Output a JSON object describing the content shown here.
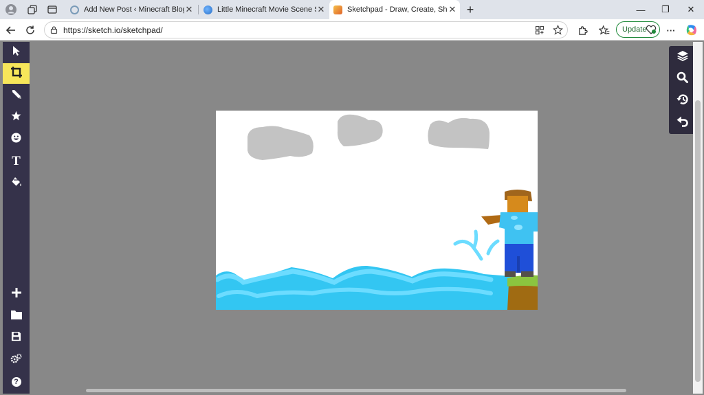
{
  "tabs": [
    {
      "title": "Add New Post ‹ Minecraft Blog — WordPress",
      "close": "✕",
      "favicon_color": "#7a9bb8"
    },
    {
      "title": "Little Minecraft Movie Scene Script",
      "close": "✕",
      "favicon_color": "#3a7bd5"
    },
    {
      "title": "Sketchpad - Draw, Create, Share!",
      "close": "✕",
      "favicon_color": "#e8a23a"
    }
  ],
  "new_tab": "+",
  "window": {
    "minimize": "—",
    "restore": "❐",
    "close": "✕"
  },
  "address": {
    "url": "https://sketch.io/sketchpad/"
  },
  "update_button": "Update",
  "more_menu": "···",
  "left_tools": [
    "select-arrow",
    "crop",
    "pencil",
    "star",
    "emoji",
    "text",
    "paint-bucket"
  ],
  "left_tools_bottom": [
    "plus",
    "folder",
    "save",
    "settings",
    "help"
  ],
  "right_tools": [
    "layers",
    "zoom",
    "history",
    "undo"
  ],
  "text_tool_glyph": "T",
  "help_glyph": "?",
  "colors": {
    "toolbar_bg": "#35324a",
    "active_tool": "#f7e65a",
    "workspace": "#888888",
    "water": "#33c6f2",
    "water_light": "#6cdcff",
    "cloud": "#c3c3c3"
  }
}
